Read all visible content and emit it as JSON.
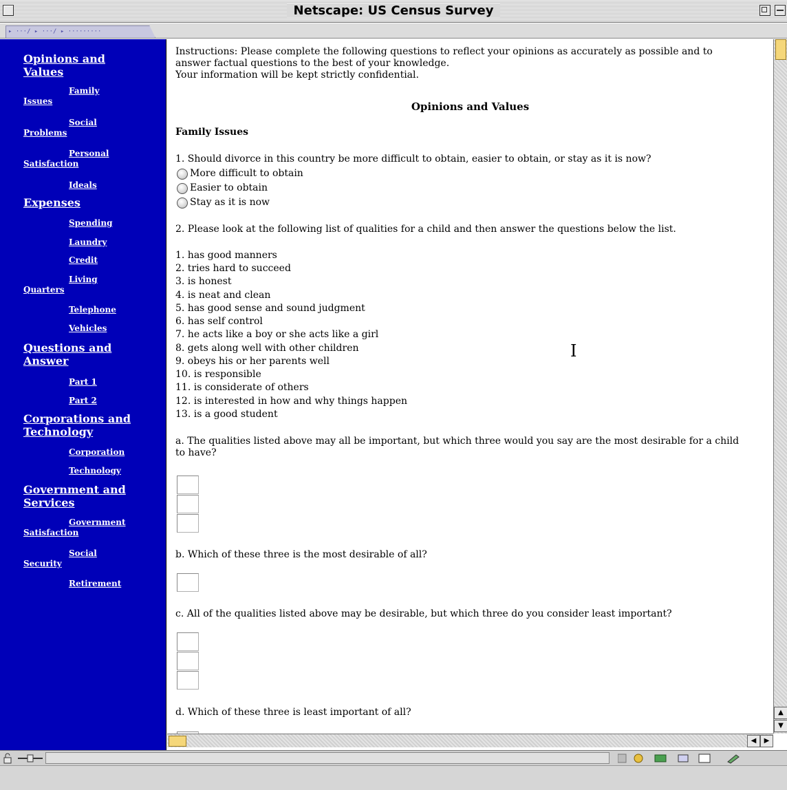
{
  "window": {
    "title": "Netscape: US Census Survey"
  },
  "toolbar": {
    "tab_label": "▸ ···/ ▸ ···/ ▸ ·········"
  },
  "sidebar": {
    "categories": [
      {
        "label_line1": "Opinions and",
        "label_line2": "Values"
      },
      {
        "label": "Expenses"
      },
      {
        "label_line1": "Questions and",
        "label_line2": "Answer"
      },
      {
        "label_line1": "Corporations and",
        "label_line2": "Technology"
      },
      {
        "label_line1": "Government and",
        "label_line2": "Services"
      }
    ],
    "subitems": {
      "family_issues": {
        "line1": "Family",
        "line2": "Issues"
      },
      "social_problems": {
        "line1": "Social",
        "line2": "Problems"
      },
      "personal_satisfaction": {
        "line1": "Personal",
        "line2": "Satisfaction"
      },
      "ideals": "Ideals",
      "spending": "Spending",
      "laundry": "Laundry",
      "credit": "Credit",
      "living_quarters": {
        "line1": "Living",
        "line2": "Quarters"
      },
      "telephone": "Telephone",
      "vehicles": "Vehicles",
      "part1": "Part 1",
      "part2": "Part 2",
      "corporation": "Corporation",
      "technology": "Technology",
      "government_satisfaction": {
        "line1": "Government",
        "line2": "Satisfaction"
      },
      "social_security": {
        "line1": "Social",
        "line2": "Security"
      },
      "retirement": "Retirement"
    }
  },
  "content": {
    "instructions_line1": "Instructions: Please complete the following questions to reflect your opinions as accurately as possible and to",
    "instructions_line2": "answer factual questions to the best of your knowledge.",
    "instructions_line3": "Your information will be kept strictly confidential.",
    "section_title": "Opinions and Values",
    "subsection_title": "Family Issues",
    "q1": {
      "text": "1. Should divorce in this country be more difficult to obtain, easier to obtain, or stay as it is now?",
      "options": [
        " More difficult to obtain",
        "Easier to obtain",
        "Stay as it is now"
      ]
    },
    "q2_intro": "2. Please look at the following list of qualities for a child and then answer the questions below the list.",
    "qualities": [
      "1. has good manners",
      "2. tries hard to succeed",
      "3. is honest",
      "4. is neat and clean",
      "5. has good sense and sound judgment",
      "6. has self control",
      "7. he acts like a boy or she acts like a girl",
      "8. gets along well with other children",
      "9. obeys his or her parents well",
      "10. is responsible",
      "11. is considerate of others",
      "12. is interested in how and why things happen",
      "13. is a good student"
    ],
    "qa_line1": "a. The qualities listed above may all be important, but which three would you say are the most desirable for a child",
    "qa_line2": "to have?",
    "qb": "b. Which of these three is the most desirable of all?",
    "qc": "c. All of the qualities listed above may be desirable, but which three do you consider least important?",
    "qd": "d. Which of these three is least important of all?"
  },
  "colors": {
    "sidebar_bg": "#0000b8",
    "sidebar_text": "#ffffff",
    "scroll_thumb": "#f5d77a"
  },
  "icons": [
    "close-box-icon",
    "zoom-box-icon",
    "collapse-box-icon",
    "scroll-up-arrow-icon",
    "scroll-down-arrow-icon",
    "scroll-left-arrow-icon",
    "scroll-right-arrow-icon",
    "security-lock-icon",
    "connection-icon",
    "component-bar-icons",
    "text-cursor-icon"
  ]
}
